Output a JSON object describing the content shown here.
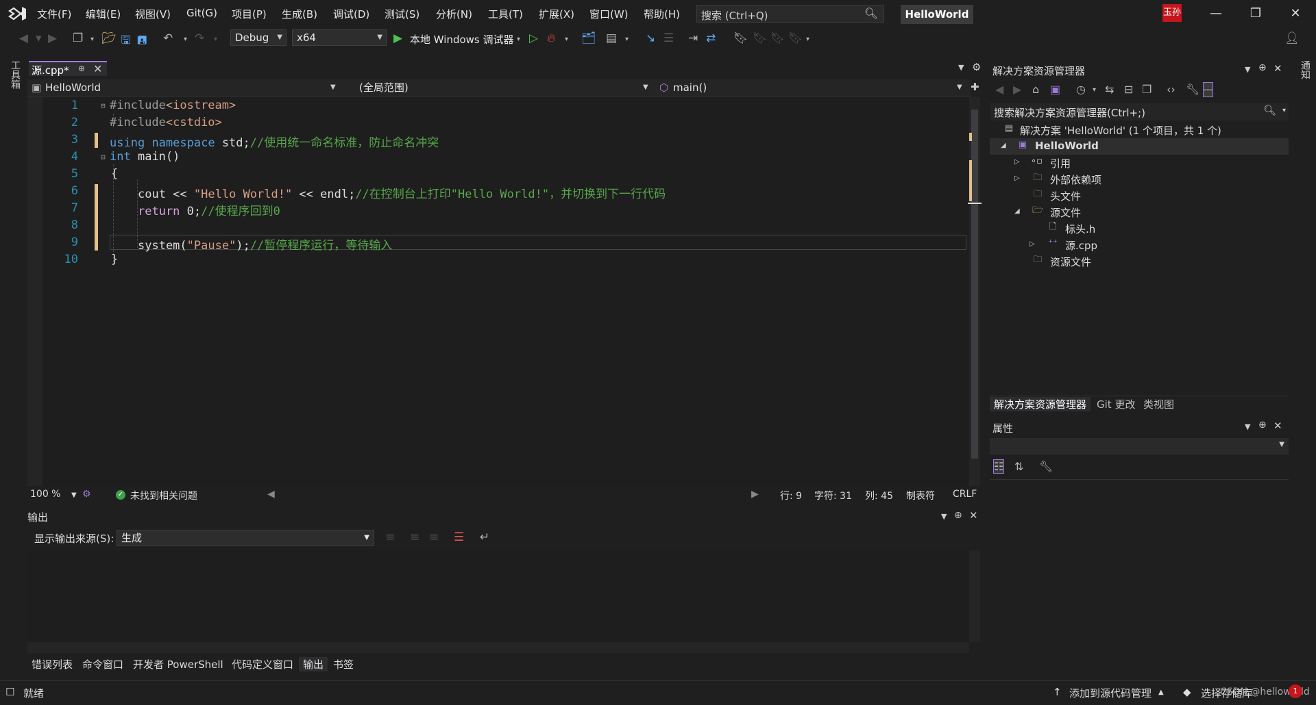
{
  "menubar": {
    "items": [
      "文件(F)",
      "编辑(E)",
      "视图(V)",
      "Git(G)",
      "项目(P)",
      "生成(B)",
      "调试(D)",
      "测试(S)",
      "分析(N)",
      "工具(T)",
      "扩展(X)",
      "窗口(W)",
      "帮助(H)"
    ],
    "search_placeholder": "搜索 (Ctrl+Q)",
    "solution_name": "HelloWorld",
    "user_initials": "玉孙"
  },
  "toolbar": {
    "configuration": "Debug",
    "platform": "x64",
    "debugger_label": "本地 Windows 调试器"
  },
  "left_sidebar": {
    "toolbox_label": "工具箱"
  },
  "right_sidebar": {
    "notifications_label": "通知"
  },
  "document": {
    "tab_name": "源.cpp*",
    "nav_project": "HelloWorld",
    "nav_scope": "(全局范围)",
    "nav_member": "main()"
  },
  "code_lines": [
    "1",
    "2",
    "3",
    "4",
    "5",
    "6",
    "7",
    "8",
    "9",
    "10"
  ],
  "code": {
    "l1_pp": "#include",
    "l1_inc": "<iostream>",
    "l2_pp": "#include",
    "l2_inc": "<cstdio>",
    "l3_kw1": "using",
    "l3_kw2": "namespace",
    "l3_ns": "std;",
    "l3_cm": "//使用统一命名标准，防止命名冲突",
    "l4_kw": "int",
    "l4_fn": "main()",
    "l5": "{",
    "l6_id": "cout << ",
    "l6_str": "\"Hello World!\"",
    "l6_id2": " << endl;",
    "l6_cm": "//在控制台上打印\"Hello World!\"，并切换到下一行代码",
    "l7_kw": "return",
    "l7_id": " 0;",
    "l7_cm": "//使程序回到0",
    "l9_fn": "system",
    "l9_id": "(",
    "l9_str": "\"Pause\"",
    "l9_id2": ");",
    "l9_cm": "//暂停程序运行，等待输入",
    "l10": "}"
  },
  "editor_status": {
    "zoom": "100 %",
    "issues": "未找到相关问题",
    "line": "行: 9",
    "char": "字符: 31",
    "col": "列: 45",
    "tabs": "制表符",
    "eol": "CRLF"
  },
  "output": {
    "title": "输出",
    "source_label": "显示输出来源(S):",
    "source_value": "生成"
  },
  "bottom_tabs": [
    "错误列表",
    "命令窗口",
    "开发者 PowerShell",
    "代码定义窗口",
    "输出",
    "书签"
  ],
  "solution_explorer": {
    "title": "解决方案资源管理器",
    "search_placeholder": "搜索解决方案资源管理器(Ctrl+;)",
    "solution_row": "解决方案 'HelloWorld' (1 个项目，共 1 个)",
    "project": "HelloWorld",
    "items": [
      "引用",
      "外部依赖项",
      "头文件",
      "源文件",
      "标头.h",
      "源.cpp",
      "资源文件"
    ],
    "tabs": [
      "解决方案资源管理器",
      "Git 更改",
      "类视图"
    ]
  },
  "properties": {
    "title": "属性"
  },
  "statusbar": {
    "ready": "就绪",
    "add_source_control": "添加到源代码管理",
    "select_repo": "选择存储库",
    "watermark": "CSDN @helloworld",
    "notif_count": "1"
  },
  "colors": {
    "accent": "#9d7bd8",
    "change_marker": "#e2c08d",
    "keyword": "#569cd6",
    "string": "#d69d85",
    "comment": "#57a64a",
    "line_number": "#2b91af"
  }
}
